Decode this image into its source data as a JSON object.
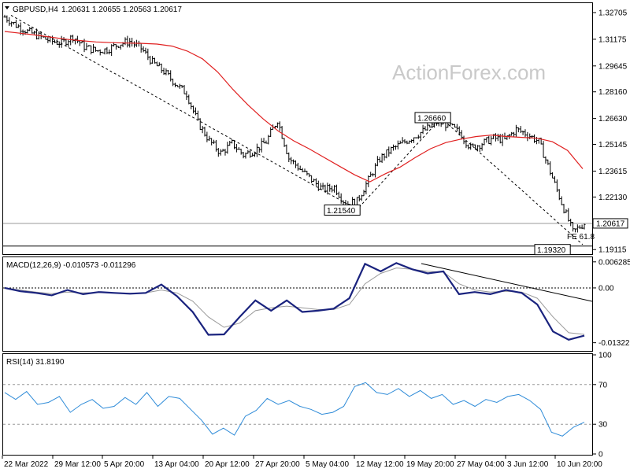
{
  "header": {
    "symbol": "GBPUSD,H4",
    "ohlc": "1.20631 1.20655 1.20563 1.20617"
  },
  "watermark": "ActionForex.com",
  "chart_data": [
    {
      "type": "candlestick",
      "title": "GBPUSD,H4",
      "ylim": [
        1.189,
        1.332
      ],
      "y_ticks": [
        "1.32705",
        "1.31175",
        "1.29645",
        "1.28160",
        "1.26630",
        "1.25145",
        "1.23615",
        "1.22130",
        "1.19115"
      ],
      "last_price_label": "1.20617",
      "last_price": 1.20617,
      "x_ticks": [
        "22 Mar 2022",
        "29 Mar 12:00",
        "5 Apr 20:00",
        "13 Apr 04:00",
        "20 Apr 12:00",
        "27 Apr 20:00",
        "5 May 04:00",
        "12 May 12:00",
        "19 May 20:00",
        "27 May 04:00",
        "3 Jun 12:00",
        "10 Jun 20:00"
      ],
      "closes": [
        1.3245,
        1.3198,
        1.3162,
        1.3135,
        1.3108,
        1.3095,
        1.3132,
        1.3075,
        1.3052,
        1.3058,
        1.309,
        1.3105,
        1.3065,
        1.2985,
        1.2932,
        1.2865,
        1.2805,
        1.264,
        1.2535,
        1.2465,
        1.252,
        1.2455,
        1.248,
        1.253,
        1.2655,
        1.2435,
        1.2372,
        1.2312,
        1.2256,
        1.227,
        1.2172,
        1.2189,
        1.231,
        1.2432,
        1.2485,
        1.2522,
        1.256,
        1.2598,
        1.2641,
        1.2628,
        1.2582,
        1.2495,
        1.252,
        1.2551,
        1.254,
        1.26,
        1.2572,
        1.253,
        1.2358,
        1.218,
        1.2012,
        1.2062
      ],
      "annotations": [
        {
          "text": "1.26660",
          "value": 1.2666
        },
        {
          "text": "1.21540",
          "value": 1.2154
        },
        {
          "text": "1.19320",
          "value": 1.1932
        },
        {
          "text": "FE 61.8",
          "value": 1.198
        }
      ],
      "moving_average": [
        1.3162,
        1.3152,
        1.3142,
        1.313,
        1.3118,
        1.311,
        1.3102,
        1.3098,
        1.3096,
        1.3094,
        1.309,
        1.3078,
        1.305,
        1.3005,
        1.293,
        1.283,
        1.274,
        1.266,
        1.259,
        1.2535,
        1.249,
        1.244,
        1.239,
        1.234,
        1.23,
        1.2345,
        1.2385,
        1.244,
        1.249,
        1.2525,
        1.2545,
        1.256,
        1.2568,
        1.256,
        1.2555,
        1.255,
        1.253,
        1.248,
        1.2375
      ]
    },
    {
      "type": "line",
      "title": "MACD(12,26,9) -0.010573 -0.011296",
      "ylim": [
        -0.015,
        0.0072
      ],
      "y_ticks": [
        "0.006285",
        "0.00",
        "-0.013223"
      ],
      "main": [
        0.0,
        -0.0008,
        -0.0012,
        -0.0018,
        -0.0005,
        -0.0015,
        -0.001,
        -0.0012,
        -0.0014,
        -0.0012,
        0.0008,
        -0.002,
        -0.0058,
        -0.0113,
        -0.0112,
        -0.007,
        -0.003,
        -0.0055,
        -0.003,
        -0.0058,
        -0.0055,
        -0.005,
        -0.0025,
        0.0058,
        0.004,
        0.006,
        0.0045,
        0.0035,
        0.004,
        -0.0015,
        -0.001,
        -0.0015,
        -0.0005,
        -0.0012,
        -0.004,
        -0.0105,
        -0.0125,
        -0.0115
      ],
      "signal": [
        0.0,
        -0.0005,
        -0.001,
        -0.0014,
        -0.001,
        -0.0012,
        -0.0011,
        -0.0012,
        -0.0013,
        -0.0012,
        -0.0005,
        -0.0012,
        -0.0032,
        -0.007,
        -0.0095,
        -0.0085,
        -0.0055,
        -0.0048,
        -0.0044,
        -0.0048,
        -0.0052,
        -0.0052,
        -0.004,
        0.001,
        0.0035,
        0.0048,
        0.0045,
        0.004,
        0.0038,
        0.001,
        -0.0005,
        -0.001,
        -0.0008,
        -0.001,
        -0.0025,
        -0.007,
        -0.0108,
        -0.0112
      ]
    },
    {
      "type": "line",
      "title": "RSI(14) 31.8190",
      "ylim": [
        0,
        100
      ],
      "y_ticks": [
        "100",
        "70",
        "30",
        "0"
      ],
      "levels": [
        70,
        30
      ],
      "values": [
        62,
        55,
        63,
        50,
        52,
        58,
        42,
        50,
        55,
        46,
        48,
        57,
        50,
        62,
        48,
        58,
        56,
        45,
        34,
        20,
        26,
        19,
        38,
        44,
        56,
        50,
        54,
        48,
        45,
        40,
        42,
        48,
        68,
        72,
        62,
        60,
        66,
        58,
        64,
        56,
        60,
        50,
        54,
        48,
        55,
        52,
        58,
        60,
        54,
        45,
        22,
        18,
        27,
        32
      ]
    }
  ]
}
